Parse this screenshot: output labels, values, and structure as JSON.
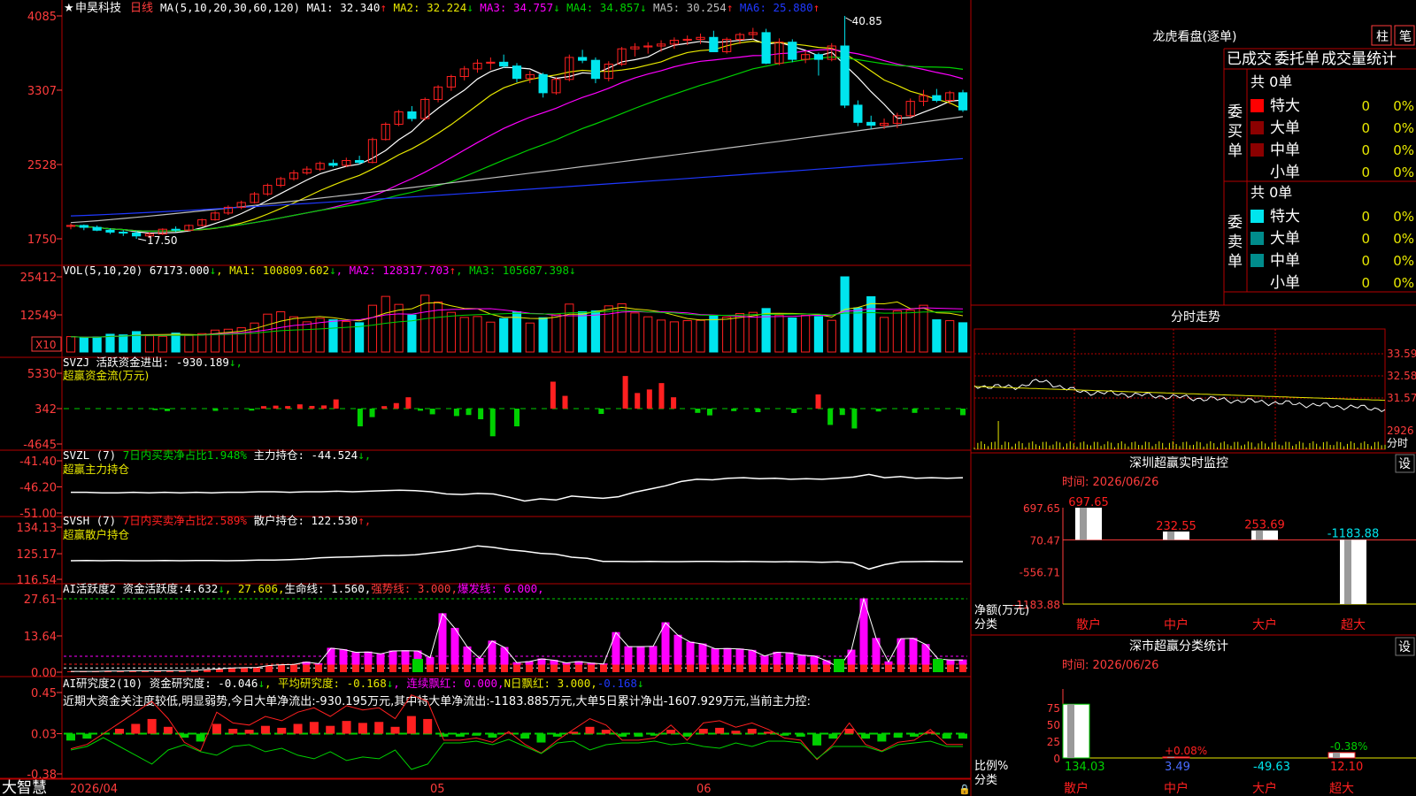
{
  "colors": {
    "bg": "#000000",
    "grid": "#b40000",
    "axis_red": "#ff3c3c",
    "up": "#ff2020",
    "down": "#00e5ee",
    "green": "#00d000",
    "yellow": "#e8e800",
    "magenta": "#ff00ff",
    "white": "#ffffff",
    "gray": "#bdbdbd",
    "blue": "#1f38ff",
    "dark_red": "#8b0000",
    "teal": "#008c8c"
  },
  "main": {
    "title": "申昊科技",
    "period": "日线",
    "ma_label": "MA(5,10,20,30,60,120)",
    "ma_values": [
      {
        "name": "MA1",
        "value": "32.340",
        "arrow": "↑",
        "color": "#ffffff"
      },
      {
        "name": "MA2",
        "value": "32.224",
        "arrow": "↓",
        "color": "#e8e800"
      },
      {
        "name": "MA3",
        "value": "34.757",
        "arrow": "↓",
        "color": "#ff00ff"
      },
      {
        "name": "MA4",
        "value": "34.857",
        "arrow": "↓",
        "color": "#00d000"
      },
      {
        "name": "MA5",
        "value": "30.254",
        "arrow": "↑",
        "color": "#bdbdbd"
      },
      {
        "name": "MA6",
        "value": "25.880",
        "arrow": "↑",
        "color": "#1f38ff"
      }
    ],
    "y_ticks": [
      "4085",
      "3307",
      "2528",
      "1750"
    ],
    "y_tick_values": [
      40.85,
      33.07,
      25.28,
      17.5
    ],
    "high_label": "40.85",
    "low_label": "17.50"
  },
  "vol": {
    "label": "VOL(5,10,20)",
    "value": "67173.000",
    "value_arrow": "↓",
    "ma_values": [
      {
        "name": "MA1",
        "value": "100809.602",
        "arrow": "↓",
        "color": "#e8e800"
      },
      {
        "name": "MA2",
        "value": "128317.703",
        "arrow": "↑",
        "color": "#ff00ff"
      },
      {
        "name": "MA3",
        "value": "105687.398",
        "arrow": "↓",
        "color": "#00d000"
      }
    ],
    "y_ticks": [
      "25412",
      "12549"
    ],
    "unit": "X10"
  },
  "svzj": {
    "label": "SVZJ",
    "field": "活跃资金进出:",
    "value": "-930.189",
    "arrow": "↓",
    "subtitle": "超赢资金流(万元)",
    "y_ticks": [
      "5330",
      "342",
      "-4645"
    ]
  },
  "svzl": {
    "label": "SVZL  (7)",
    "ratio_text": "7日内买卖净占比1.948%",
    "field": "主力持仓:",
    "value": "-44.524",
    "arrow": "↓",
    "subtitle": "超赢主力持仓",
    "y_ticks": [
      "-41.40",
      "-46.20",
      "-51.00"
    ]
  },
  "svsh": {
    "label": "SVSH  (7)",
    "ratio_text": "7日内买卖净占比2.589%",
    "field": "散户持仓:",
    "value": "122.530",
    "arrow": "↑",
    "subtitle": "超赢散户持仓",
    "y_ticks": [
      "134.13",
      "125.17",
      "116.54"
    ]
  },
  "ai_active": {
    "label": "AI活跃度2",
    "items": [
      {
        "text": "资金活跃度:",
        "color": "#ffffff"
      },
      {
        "text": "4.632",
        "color": "#ffffff"
      },
      {
        "text": "↓",
        "color": "#00d000"
      },
      {
        "text": ", 27.606,",
        "color": "#e8e800"
      },
      {
        "text": "生命线: 1.560,",
        "color": "#ffffff"
      },
      {
        "text": "强势线: 3.000,",
        "color": "#ff3c3c"
      },
      {
        "text": "爆发线: 6.000,",
        "color": "#ff00ff"
      }
    ],
    "y_ticks": [
      "27.61",
      "13.64",
      "0.00"
    ]
  },
  "ai_research": {
    "label": "AI研究度2(10)",
    "items": [
      {
        "text": "资金研究度: -0.046",
        "color": "#ffffff"
      },
      {
        "text": "↓",
        "color": "#00d000"
      },
      {
        "text": ", 平均研究度: -0.168",
        "color": "#e8e800"
      },
      {
        "text": "↓",
        "color": "#00d000"
      },
      {
        "text": ", 连续飘红: 0.000,",
        "color": "#ff00ff"
      },
      {
        "text": "N日飘红: 3.000,",
        "color": "#e8e800"
      },
      {
        "text": "-0.168",
        "color": "#1f38ff"
      },
      {
        "text": "↓",
        "color": "#00d000"
      }
    ],
    "commentary": "近期大资金关注度较低,明显弱势,今日大单净流出:-930.195万元,其中特大单净流出:-1183.885万元,大单5日累计净出-1607.929万元,当前主力控:",
    "y_ticks": [
      "0.45",
      "0.03",
      "-0.38"
    ]
  },
  "footer": {
    "brand": "大智慧",
    "dates": [
      "2026/04",
      "05",
      "06"
    ]
  },
  "right": {
    "dragon_title": "龙虎看盘(逐单)",
    "btn_bar": "柱",
    "btn_pen": "笔",
    "tabs": [
      "已成交",
      "委托单",
      "成交量统计"
    ],
    "buy_group": {
      "label": "委买单",
      "total": "共 0单",
      "rows": [
        {
          "name": "特大",
          "value": "0",
          "pct": "0%",
          "color": "#ff0000"
        },
        {
          "name": "大单",
          "value": "0",
          "pct": "0%",
          "color": "#8b0000"
        },
        {
          "name": "中单",
          "value": "0",
          "pct": "0%",
          "color": "#8b0000"
        },
        {
          "name": "小单",
          "value": "0",
          "pct": "0%",
          "color": ""
        }
      ]
    },
    "sell_group": {
      "label": "委卖单",
      "total": "共 0单",
      "rows": [
        {
          "name": "特大",
          "value": "0",
          "pct": "0%",
          "color": "#00e5ee"
        },
        {
          "name": "大单",
          "value": "0",
          "pct": "0%",
          "color": "#008c8c"
        },
        {
          "name": "中单",
          "value": "0",
          "pct": "0%",
          "color": "#008c8c"
        },
        {
          "name": "小单",
          "value": "0",
          "pct": "0%",
          "color": ""
        }
      ]
    },
    "intraday": {
      "title": "分时走势",
      "y_ticks": [
        "33.59",
        "32.58",
        "31.57",
        "2926"
      ],
      "bottom_label": "分时"
    },
    "monitor": {
      "title": "深圳超赢实时监控",
      "settings": "设",
      "time_label": "时间: 2026/06/26",
      "y_ticks": [
        "697.65",
        "70.47",
        "-556.71",
        "-1183.88"
      ],
      "axis_label_1": "净额(万元)",
      "axis_label_2": "分类",
      "categories": [
        "散户",
        "中户",
        "大户",
        "超大"
      ]
    },
    "classify": {
      "title": "深市超赢分类统计",
      "settings": "设",
      "time_label": "时间: 2026/06/26",
      "y_ticks": [
        "75",
        "50",
        "25",
        "0"
      ],
      "axis_label_1": "比例%",
      "axis_label_2": "分类",
      "categories": [
        "散户",
        "中户",
        "大户",
        "超大"
      ]
    }
  },
  "chart_data": [
    {
      "type": "candlestick",
      "title": "申昊科技 日线",
      "ylim": [
        17.5,
        40.85
      ],
      "dates_shown": [
        "2026/04",
        "05",
        "06"
      ],
      "ohlc": [
        [
          18.8,
          19.1,
          18.5,
          18.9
        ],
        [
          18.9,
          19.0,
          18.4,
          18.7
        ],
        [
          18.7,
          18.9,
          18.3,
          18.4
        ],
        [
          18.4,
          18.6,
          18.0,
          18.2
        ],
        [
          18.2,
          18.4,
          17.8,
          18.1
        ],
        [
          18.1,
          18.3,
          17.5,
          17.8
        ],
        [
          17.8,
          18.2,
          17.6,
          18.0
        ],
        [
          18.0,
          18.6,
          17.9,
          18.5
        ],
        [
          18.5,
          18.8,
          18.2,
          18.4
        ],
        [
          18.4,
          19.0,
          18.3,
          18.9
        ],
        [
          18.9,
          19.6,
          18.8,
          19.5
        ],
        [
          19.5,
          20.4,
          19.4,
          20.2
        ],
        [
          20.2,
          21.0,
          20.0,
          20.8
        ],
        [
          20.8,
          21.5,
          20.6,
          21.3
        ],
        [
          21.3,
          22.4,
          21.2,
          22.2
        ],
        [
          22.2,
          23.3,
          22.0,
          23.1
        ],
        [
          23.1,
          24.0,
          22.9,
          23.8
        ],
        [
          23.8,
          24.7,
          23.6,
          24.4
        ],
        [
          24.4,
          25.1,
          24.2,
          24.8
        ],
        [
          24.8,
          25.6,
          24.6,
          25.4
        ],
        [
          25.4,
          25.8,
          25.0,
          25.2
        ],
        [
          25.2,
          26.0,
          25.0,
          25.7
        ],
        [
          25.7,
          26.2,
          25.3,
          25.5
        ],
        [
          25.5,
          28.1,
          25.4,
          27.9
        ],
        [
          27.9,
          29.7,
          27.8,
          29.5
        ],
        [
          29.5,
          31.0,
          29.3,
          30.8
        ],
        [
          30.8,
          31.4,
          29.8,
          30.1
        ],
        [
          30.1,
          32.3,
          29.9,
          32.1
        ],
        [
          32.1,
          33.6,
          31.8,
          33.4
        ],
        [
          33.4,
          34.7,
          33.0,
          34.5
        ],
        [
          34.5,
          35.6,
          34.1,
          35.3
        ],
        [
          35.3,
          36.3,
          34.9,
          35.9
        ],
        [
          35.9,
          36.5,
          35.2,
          36.0
        ],
        [
          36.0,
          36.8,
          35.4,
          35.6
        ],
        [
          35.6,
          35.9,
          33.9,
          34.3
        ],
        [
          34.3,
          35.1,
          33.8,
          34.7
        ],
        [
          34.7,
          34.9,
          32.3,
          32.8
        ],
        [
          32.8,
          34.4,
          32.6,
          34.2
        ],
        [
          34.2,
          36.8,
          34.0,
          36.5
        ],
        [
          36.5,
          37.3,
          35.9,
          36.2
        ],
        [
          36.2,
          36.5,
          33.8,
          34.3
        ],
        [
          34.3,
          36.1,
          34.0,
          35.8
        ],
        [
          35.8,
          37.6,
          35.6,
          37.4
        ],
        [
          37.4,
          38.0,
          36.6,
          37.6
        ],
        [
          37.6,
          38.1,
          36.9,
          37.7
        ],
        [
          37.7,
          38.3,
          37.1,
          37.9
        ],
        [
          37.9,
          38.6,
          37.4,
          38.3
        ],
        [
          38.3,
          38.8,
          37.8,
          38.4
        ],
        [
          38.4,
          39.0,
          37.9,
          38.6
        ],
        [
          38.6,
          39.3,
          37.2,
          37.1
        ],
        [
          37.1,
          38.6,
          36.9,
          38.4
        ],
        [
          38.4,
          39.1,
          37.9,
          38.9
        ],
        [
          38.9,
          39.6,
          38.4,
          39.1
        ],
        [
          39.1,
          39.5,
          35.8,
          35.9
        ],
        [
          35.9,
          38.5,
          35.7,
          38.1
        ],
        [
          38.1,
          38.4,
          36.0,
          36.3
        ],
        [
          36.3,
          37.2,
          35.9,
          36.8
        ],
        [
          36.8,
          37.0,
          34.6,
          36.3
        ],
        [
          36.3,
          38.0,
          36.1,
          37.7
        ],
        [
          37.7,
          40.85,
          31.2,
          31.5
        ],
        [
          31.5,
          32.0,
          29.3,
          29.7
        ],
        [
          29.7,
          30.4,
          29.0,
          29.4
        ],
        [
          29.4,
          30.1,
          29.0,
          29.6
        ],
        [
          29.6,
          30.7,
          29.1,
          30.4
        ],
        [
          30.4,
          32.2,
          30.2,
          31.9
        ],
        [
          31.9,
          33.1,
          31.4,
          32.5
        ],
        [
          32.5,
          33.2,
          31.8,
          32.0
        ],
        [
          32.0,
          33.0,
          31.6,
          32.8
        ],
        [
          32.8,
          33.1,
          30.8,
          31.0
        ]
      ],
      "moving_averages": {
        "MA1": 32.34,
        "MA2": 32.224,
        "MA3": 34.757,
        "MA4": 34.857,
        "MA5": 30.254,
        "MA6": 25.88
      },
      "high": 40.85,
      "low": 17.5
    },
    {
      "type": "bar",
      "title": "VOL(5,10,20)",
      "unit": "X10",
      "ylim": [
        0,
        25412
      ],
      "values": [
        5200,
        4800,
        5100,
        6000,
        5800,
        6900,
        5500,
        5300,
        6400,
        5600,
        6200,
        7400,
        7700,
        8200,
        9800,
        12800,
        13600,
        11900,
        10200,
        11400,
        10900,
        10300,
        9900,
        15800,
        18800,
        16100,
        12500,
        19200,
        16900,
        13400,
        11700,
        12000,
        10100,
        11300,
        13600,
        9800,
        11600,
        12800,
        16200,
        13600,
        13900,
        15600,
        16300,
        13200,
        11900,
        10800,
        10200,
        10600,
        10700,
        12200,
        11800,
        13000,
        13400,
        14700,
        12500,
        11500,
        12400,
        12000,
        10700,
        25412,
        14900,
        18700,
        11700,
        13900,
        14100,
        15800,
        10900,
        10600,
        9900
      ],
      "ma_values": {
        "MA1": 100809.602,
        "MA2": 128317.703,
        "MA3": 105687.398
      },
      "last": 67173.0
    },
    {
      "type": "bar",
      "title": "超赢资金流(万元)",
      "ylim": [
        -4645,
        5330
      ],
      "values": [
        0,
        0,
        0,
        0,
        0,
        0,
        0,
        -200,
        -350,
        0,
        0,
        0,
        -320,
        0,
        0,
        -280,
        350,
        420,
        360,
        600,
        380,
        450,
        1300,
        0,
        -2500,
        -1200,
        350,
        780,
        1600,
        -300,
        -800,
        0,
        -1050,
        -900,
        -1500,
        -3900,
        0,
        -2500,
        0,
        0,
        3800,
        1800,
        0,
        0,
        -750,
        0,
        4600,
        2200,
        2700,
        3600,
        1600,
        0,
        -600,
        -950,
        0,
        -350,
        0,
        -500,
        0,
        0,
        -620,
        0,
        2000,
        -2300,
        -900,
        -2800,
        0,
        -400,
        0,
        0,
        -600,
        0,
        0,
        0,
        -930
      ]
    },
    {
      "type": "line",
      "title": "超赢主力持仓",
      "ylim": [
        -51.0,
        -41.4
      ],
      "last": -44.524
    },
    {
      "type": "line",
      "title": "超赢散户持仓",
      "ylim": [
        116.54,
        134.13
      ],
      "last": 122.53
    },
    {
      "type": "bar",
      "title": "AI活跃度2",
      "ylim": [
        0,
        27.61
      ],
      "values": [
        0.3,
        0.3,
        0.3,
        0.4,
        0.4,
        0.5,
        0.5,
        0.5,
        0.6,
        0.6,
        0.7,
        1.0,
        1.2,
        1.6,
        1.7,
        1.8,
        2.5,
        2.8,
        2.9,
        3.8,
        3.2,
        9.0,
        8.5,
        7.5,
        7.6,
        6.9,
        8.0,
        8.1,
        8.0,
        5.5,
        22.0,
        16.5,
        9.5,
        5.2,
        11.7,
        9.3,
        3.6,
        4.0,
        5.0,
        4.5,
        3.5,
        4.0,
        3.4,
        3.1,
        14.9,
        9.6,
        9.6,
        9.7,
        18.6,
        13.9,
        11.3,
        10.6,
        8.8,
        8.9,
        8.7,
        8.2,
        6.1,
        7.5,
        7.3,
        6.4,
        6.1,
        4.3,
        1.7,
        8.3,
        27.6,
        12.7,
        3.9,
        12.6,
        12.7,
        10.4,
        5.0,
        4.6,
        4.6
      ]
    },
    {
      "type": "bar",
      "title": "AI研究度2(10)",
      "ylim": [
        -0.38,
        0.45
      ],
      "values": [
        -0.07,
        -0.05,
        0.0,
        0.05,
        0.1,
        0.15,
        0.07,
        -0.04,
        -0.08,
        0.1,
        0.05,
        0.04,
        0.08,
        0.06,
        0.1,
        0.12,
        0.08,
        0.13,
        0.11,
        0.12,
        0.07,
        0.18,
        0.15,
        -0.03,
        -0.03,
        -0.02,
        -0.04,
        0.01,
        -0.05,
        -0.09,
        -0.03,
        0.02,
        0.07,
        0.04,
        -0.03,
        -0.03,
        -0.02,
        0.04,
        -0.03,
        0.05,
        0.06,
        0.03,
        0.05,
        0.02,
        -0.02,
        -0.03,
        -0.12,
        -0.05,
        0.05,
        -0.05,
        -0.08,
        -0.04,
        -0.03,
        0.02,
        -0.05,
        -0.05
      ]
    },
    {
      "type": "bar",
      "title": "深圳超赢实时监控",
      "categories": [
        "散户",
        "中户",
        "大户",
        "超大"
      ],
      "values": [
        697.65,
        232.55,
        253.69,
        -1183.88
      ],
      "ylim": [
        -1183.88,
        697.65
      ]
    },
    {
      "type": "bar",
      "title": "深市超赢分类统计",
      "categories": [
        "散户",
        "中户",
        "大户",
        "超大"
      ],
      "values": [
        134.03,
        3.49,
        -49.63,
        12.1
      ],
      "pct_labels": [
        "",
        "+0.08%",
        "",
        "-0.38%"
      ],
      "ylim": [
        0,
        75
      ]
    }
  ]
}
